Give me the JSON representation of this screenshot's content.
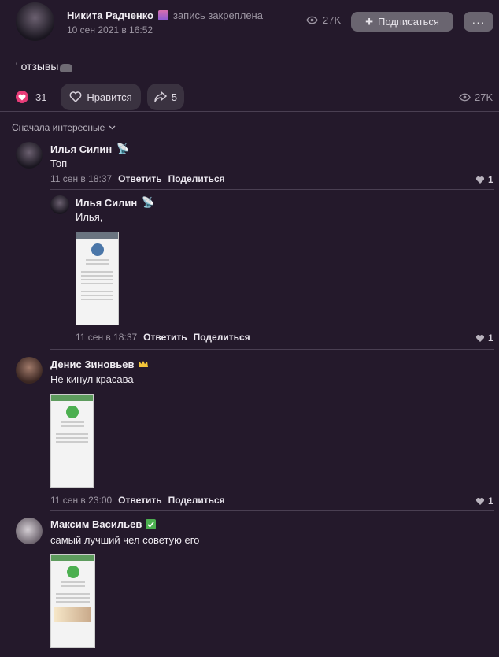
{
  "post": {
    "author": "Никита Радченко",
    "pinned_label": "запись закреплена",
    "date": "10 сен 2021 в 16:52",
    "views": "27K",
    "subscribe_label": "Подписаться",
    "more_label": "···",
    "text": "' отзывы",
    "likes_count": "31",
    "like_label": "Нравится",
    "shares_count": "5",
    "views_footer": "27K"
  },
  "sort": {
    "label": "Сначала интересные"
  },
  "comments": [
    {
      "author": "Илья Силин",
      "text": "Топ",
      "date": "11 сен в 18:37",
      "reply": "Ответить",
      "share": "Поделиться",
      "likes": "1"
    },
    {
      "author": "Илья Силин",
      "text": "Илья,",
      "date": "11 сен в 18:37",
      "reply": "Ответить",
      "share": "Поделиться",
      "likes": "1"
    },
    {
      "author": "Денис Зиновьев",
      "text": "Не кинул красава",
      "date": "11 сен в 23:00",
      "reply": "Ответить",
      "share": "Поделиться",
      "likes": "1"
    },
    {
      "author": "Максим Васильев",
      "text": "самый лучший чел советую его"
    }
  ],
  "colors": {
    "background": "#24192b",
    "heart": "#e83c78",
    "check": "#4caf50"
  }
}
